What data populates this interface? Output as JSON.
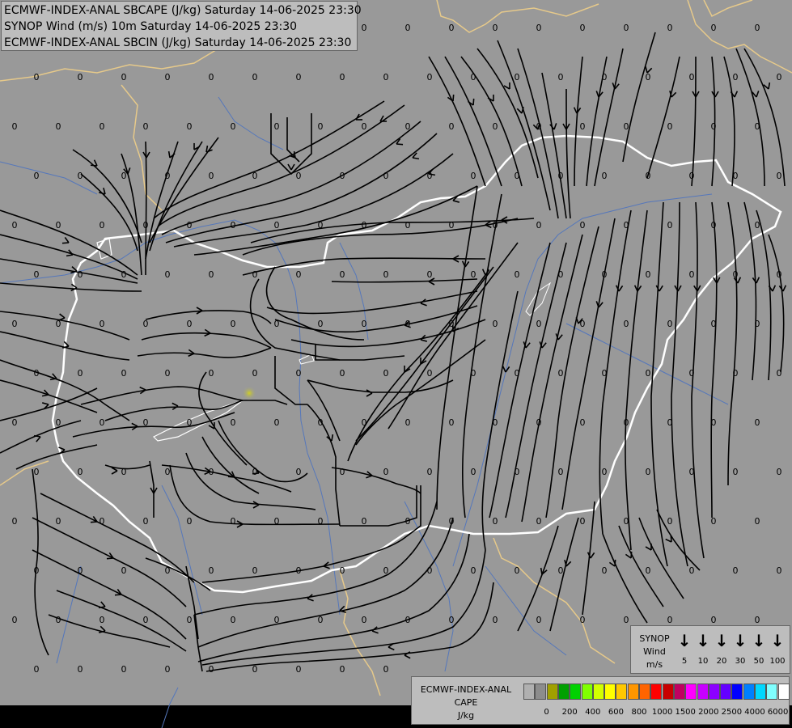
{
  "header": {
    "line1": "ECMWF-INDEX-ANAL SBCAPE (J/kg) Saturday 14-06-2025 23:30",
    "line2": "SYNOP Wind (m/s) 10m Saturday 14-06-2025 23:30",
    "line3": "ECMWF-INDEX-ANAL SBCIN (J/kg) Saturday 14-06-2025 23:30"
  },
  "map": {
    "background_color": "#999999",
    "border_color": "#ffffff",
    "neighbour_border_color": "#e6c98a",
    "river_color": "#5577bb",
    "streamline_color": "#000000",
    "value_label": "0"
  },
  "wind_legend": {
    "title_line1": "SYNOP",
    "title_line2": "Wind",
    "title_line3": "m/s",
    "icon": "down-arrow-icon",
    "arrow_glyph": "↓",
    "labels": [
      "5",
      "10",
      "20",
      "30",
      "50",
      "100"
    ]
  },
  "cape_legend": {
    "title_line1": "ECMWF-INDEX-ANAL",
    "title_line2": "CAPE",
    "title_line3": "J/kg",
    "colors": [
      "#b0b0b0",
      "#8c8c8c",
      "#a0a000",
      "#00a000",
      "#00d200",
      "#80ff00",
      "#d2ff00",
      "#ffff00",
      "#ffc800",
      "#ff9600",
      "#ff6400",
      "#ff0000",
      "#c80000",
      "#c00060",
      "#ff00ff",
      "#c800ff",
      "#8c00ff",
      "#6400ff",
      "#0000ff",
      "#0080ff",
      "#00d8ff",
      "#80ffff",
      "#ffffff"
    ],
    "labels": [
      "0",
      "200",
      "400",
      "600",
      "800",
      "1000",
      "1500",
      "2000",
      "2500",
      "4000",
      "6000"
    ]
  }
}
